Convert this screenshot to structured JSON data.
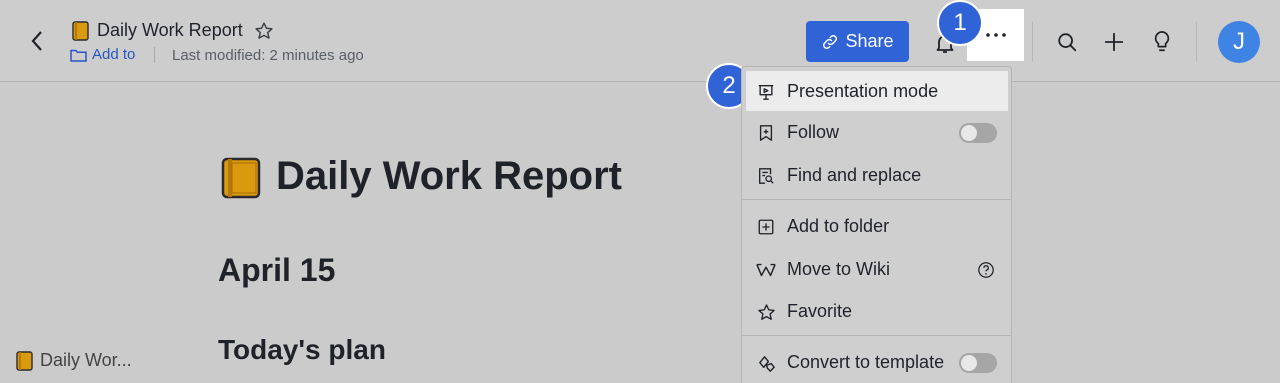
{
  "header": {
    "title": "Daily Work Report",
    "add_to": "Add to",
    "last_modified": "Last modified: 2 minutes ago",
    "share_label": "Share",
    "avatar_initial": "J"
  },
  "document": {
    "title": "Daily Work Report",
    "date_heading": "April 15",
    "plan_heading": "Today's plan",
    "outline_item": "Daily Wor..."
  },
  "menu": {
    "items": [
      {
        "label": "Presentation mode",
        "icon": "presentation-icon"
      },
      {
        "label": "Follow",
        "icon": "bookmark-icon",
        "toggle": false
      },
      {
        "label": "Find and replace",
        "icon": "find-replace-icon"
      },
      {
        "label": "Add to folder",
        "icon": "add-folder-icon"
      },
      {
        "label": "Move to Wiki",
        "icon": "wiki-icon"
      },
      {
        "label": "Favorite",
        "icon": "star-icon"
      },
      {
        "label": "Convert to template",
        "icon": "template-icon",
        "toggle": false
      }
    ]
  },
  "step_markers": [
    "1",
    "2"
  ],
  "colors": {
    "accent": "#2f63d6",
    "avatar": "#3f83e4"
  }
}
